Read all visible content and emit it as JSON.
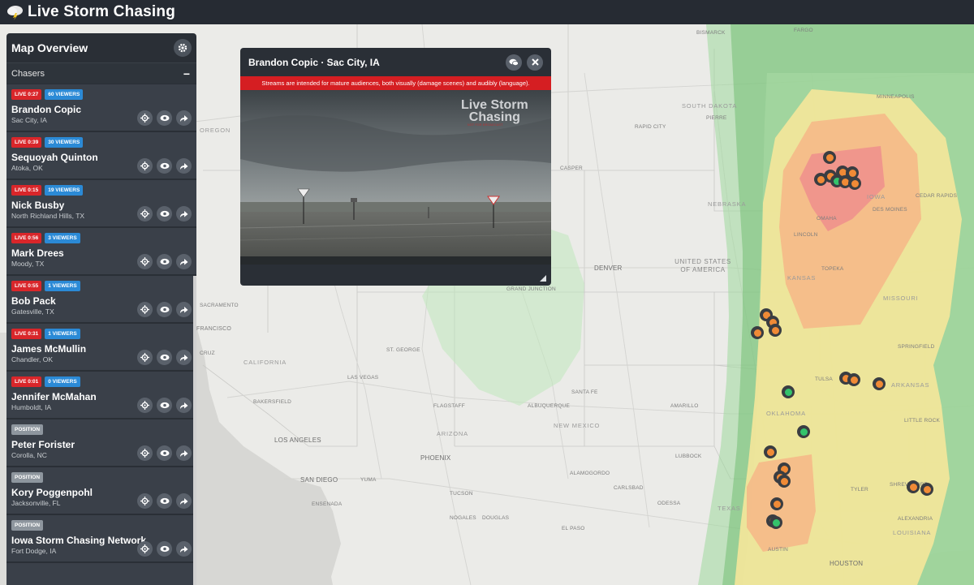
{
  "app": {
    "title": "Live Storm Chasing"
  },
  "sidebar": {
    "title": "Map Overview",
    "section": "Chasers",
    "chasers": [
      {
        "status": "LIVE 0:27",
        "viewers": "60 VIEWERS",
        "name": "Brandon Copic",
        "location": "Sac City, IA"
      },
      {
        "status": "LIVE 0:39",
        "viewers": "30 VIEWERS",
        "name": "Sequoyah Quinton",
        "location": "Atoka, OK"
      },
      {
        "status": "LIVE 0:15",
        "viewers": "19 VIEWERS",
        "name": "Nick Busby",
        "location": "North Richland Hills, TX"
      },
      {
        "status": "LIVE 0:56",
        "viewers": "3 VIEWERS",
        "name": "Mark Drees",
        "location": "Moody, TX"
      },
      {
        "status": "LIVE 0:55",
        "viewers": "1 VIEWERS",
        "name": "Bob Pack",
        "location": "Gatesville, TX"
      },
      {
        "status": "LIVE 0:31",
        "viewers": "1 VIEWERS",
        "name": "James McMullin",
        "location": "Chandler, OK"
      },
      {
        "status": "LIVE 0:01",
        "viewers": "0 VIEWERS",
        "name": "Jennifer McMahan",
        "location": "Humboldt, IA"
      },
      {
        "status": "POSITION",
        "viewers": "",
        "name": "Peter Forister",
        "location": "Corolla, NC"
      },
      {
        "status": "POSITION",
        "viewers": "",
        "name": "Kory Poggenpohl",
        "location": "Jacksonville, FL"
      },
      {
        "status": "POSITION",
        "viewers": "",
        "name": "Iowa Storm Chasing Network",
        "location": "Fort Dodge, IA"
      },
      {
        "status": "",
        "viewers": "",
        "name": "",
        "location": ""
      }
    ]
  },
  "stream": {
    "title": "Brandon Copic · Sac City, IA",
    "warning": "Streams are intended for mature audiences, both visually (damage scenes) and audibly (language).",
    "watermark_line1": "Live Storm",
    "watermark_line2": "Chasing",
    "watermark_sub": "NOT FOR BROADCAST"
  },
  "map": {
    "cities": [
      "BISMARCK",
      "FARGO",
      "MINNEAPOLIS",
      "SOUTH DAKOTA",
      "PIERRE",
      "RAPID CITY",
      "CASPER",
      "NEBRASKA",
      "IOWA",
      "DES MOINES",
      "CEDAR RAPIDS",
      "OMAHA",
      "LINCOLN",
      "DENVER",
      "KANSAS",
      "TOPEKA",
      "MISSOURI",
      "GRAND JUNCTION",
      "SPRINGFIELD",
      "TULSA",
      "ARKANSAS",
      "OKLAHOMA",
      "LITTLE ROCK",
      "AMARILLO",
      "SANTA FE",
      "NEW MEXICO",
      "ALBUQUERQUE",
      "LUBBOCK",
      "ALAMOGORDO",
      "CARLSBAD",
      "ODESSA",
      "EL PASO",
      "TYLER",
      "SHREVEPORT",
      "ALEXANDRIA",
      "LOUISIANA",
      "AUSTIN",
      "HOUSTON",
      "PHOENIX",
      "TUCSON",
      "YUMA",
      "NOGALES",
      "DOUGLAS",
      "SAN DIEGO",
      "ENSENADA",
      "LOS ANGELES",
      "BAKERSFIELD",
      "LAS VEGAS",
      "FLAGSTAFF",
      "ARIZONA",
      "ST. GEORGE",
      "CALIFORNIA",
      "OREGON",
      "SACRAMENTO",
      "FRANCISCO",
      "CRUZ",
      "TEXAS"
    ],
    "country": "UNITED STATES OF AMERICA"
  }
}
